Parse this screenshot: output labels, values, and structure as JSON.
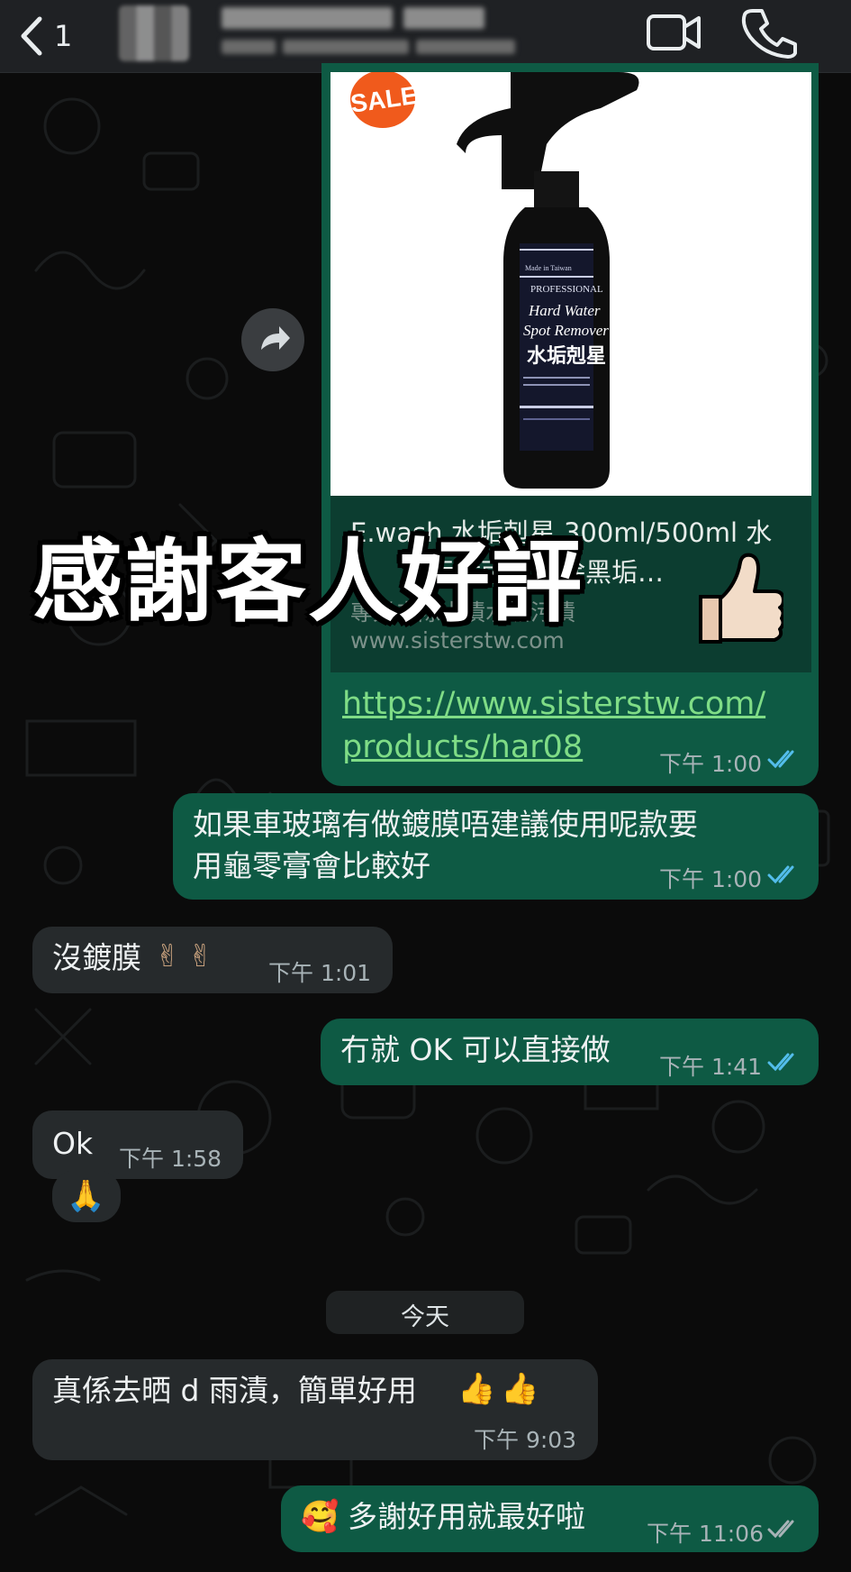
{
  "header": {
    "back_count": "1",
    "icons": {
      "back": "chevron-left-icon",
      "video": "video-camera-icon",
      "phone": "phone-icon"
    }
  },
  "link_message": {
    "preview_title_line1": "E.wash 水垢剋星 300ml/500ml 水",
    "preview_title_line2": "印污漬雨天後除黑垢…",
    "preview_desc": "專業去除水漬水垢污漬",
    "preview_url": "www.sisterstw.com",
    "product_label": {
      "brand": "Made in Taiwan",
      "line1": "PROFESSIONAL",
      "line2": "Hard Water",
      "line3": "Spot Remover",
      "line4": "水垢剋星"
    },
    "sale_badge": "SALE!",
    "link_line1": "https://www.sisterstw.com/",
    "link_line2": "products/har08",
    "time": "下午 1:00"
  },
  "overlay_caption": "感謝客人好評",
  "messages": [
    {
      "direction": "out",
      "line1": "如果車玻璃有做鍍膜唔建議使用呢款要",
      "line2": "用龜零膏會比較好",
      "time": "下午 1:00"
    },
    {
      "direction": "in",
      "text": "沒鍍膜",
      "emoji": "✌✌",
      "time": "下午 1:01"
    },
    {
      "direction": "out",
      "text": "冇就 OK 可以直接做",
      "time": "下午 1:41"
    },
    {
      "direction": "in",
      "text": "Ok",
      "time": "下午 1:58"
    },
    {
      "direction": "in",
      "emoji": "🙏"
    },
    {
      "direction": "in",
      "text": "真係去晒 d 雨漬，簡單好用",
      "emoji": "👍👍",
      "time": "下午 9:03"
    },
    {
      "direction": "out",
      "emoji": "🥰",
      "text": "多謝好用就最好啦",
      "time": "下午 11:06"
    }
  ],
  "date_divider": "今天",
  "colors": {
    "outgoing": "#0e5a44",
    "incoming": "#262a2c",
    "link": "#7fdc86",
    "read_ticks": "#53bdeb"
  }
}
